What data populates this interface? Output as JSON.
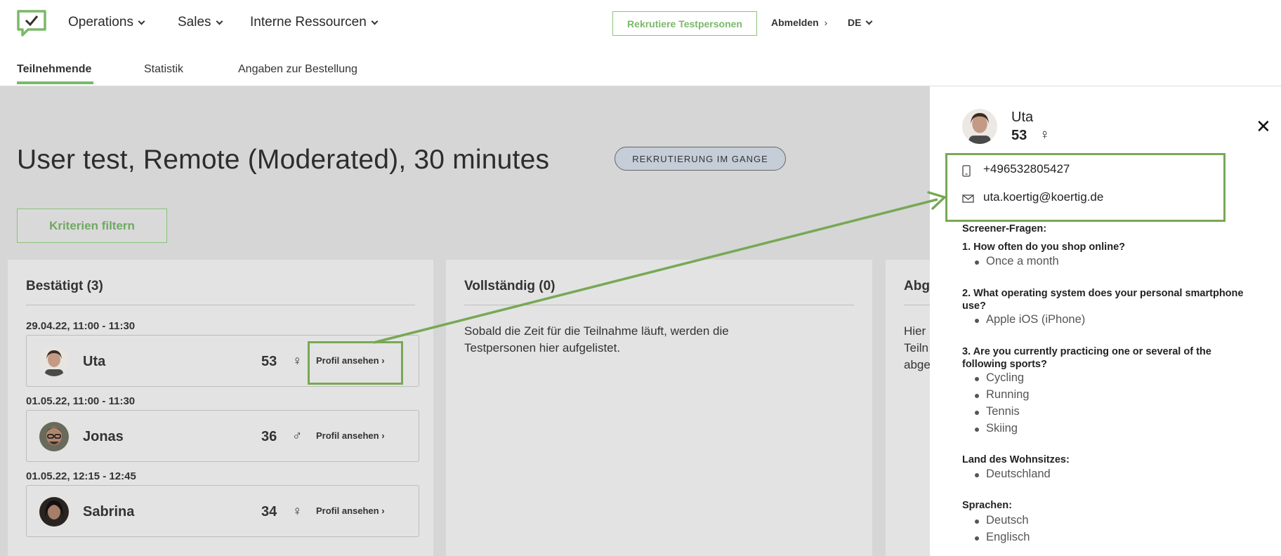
{
  "nav": {
    "items": [
      "Operations",
      "Sales",
      "Interne Ressourcen"
    ],
    "recruit_button": "Rekrutiere Testpersonen",
    "logout": "Abmelden",
    "logout_arrow": "›",
    "language": "DE"
  },
  "tabs": [
    "Teilnehmende",
    "Statistik",
    "Angaben zur Bestellung"
  ],
  "page": {
    "title": "User test, Remote (Moderated), 30 minutes",
    "status": "REKRUTIERUNG IM GANGE",
    "filter_button": "Kriterien filtern"
  },
  "columns": [
    {
      "title": "Bestätigt (3)"
    },
    {
      "title": "Vollständig (0)",
      "text": "Sobald die Zeit für die Teilnahme läuft, werden die Testpersonen hier aufgelistet."
    },
    {
      "title": "Abg",
      "text": "Hier\nTeiln\nabge"
    }
  ],
  "participants": [
    {
      "slot": "29.04.22, 11:00 - 11:30",
      "name": "Uta",
      "age": "53",
      "gender": "♀",
      "link": "Profil ansehen  ›"
    },
    {
      "slot": "01.05.22, 11:00 - 11:30",
      "name": "Jonas",
      "age": "36",
      "gender": "♂",
      "link": "Profil ansehen  ›"
    },
    {
      "slot": "01.05.22, 12:15 - 12:45",
      "name": "Sabrina",
      "age": "34",
      "gender": "♀",
      "link": "Profil ansehen  ›"
    }
  ],
  "panel": {
    "name": "Uta",
    "age": "53",
    "gender": "♀",
    "close": "✕",
    "phone": "+496532805427",
    "email": "uta.koertig@koertig.de",
    "screener_label": "Screener-Fragen:",
    "questions": [
      {
        "q": "1. How often do you shop online?",
        "answers": [
          "Once a month"
        ]
      },
      {
        "q": "2. What operating system does your personal smartphone use?",
        "answers": [
          "Apple iOS (iPhone)"
        ]
      },
      {
        "q": "3. Are you currently practicing one or several of the following sports?",
        "answers": [
          "Cycling",
          "Running",
          "Tennis",
          "Skiing"
        ]
      }
    ],
    "residence_label": "Land des Wohnsitzes:",
    "residence": [
      "Deutschland"
    ],
    "languages_label": "Sprachen:",
    "languages": [
      "Deutsch",
      "Englisch"
    ]
  },
  "colors": {
    "accent": "#7ab96a",
    "highlight": "#78a855",
    "badge_bg": "#c5ced8"
  },
  "icons": {
    "logo": "chat-check-logo",
    "phone": "phone-icon",
    "email": "mail-icon",
    "close": "close-icon"
  }
}
